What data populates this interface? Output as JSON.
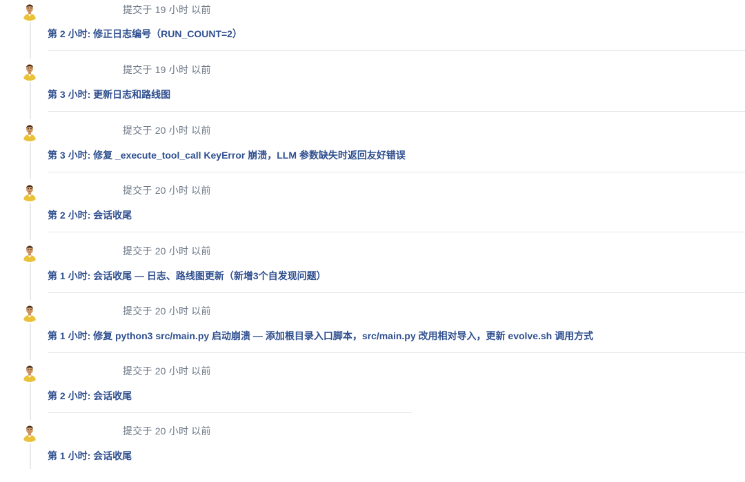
{
  "commits": [
    {
      "meta": "提交于 19 小时 以前",
      "title": "第 2 小时: 修正日志编号（RUN_COUNT=2）"
    },
    {
      "meta": "提交于 19 小时 以前",
      "title": "第 3 小时: 更新日志和路线图"
    },
    {
      "meta": "提交于 20 小时 以前",
      "title": "第 3 小时: 修复 _execute_tool_call KeyError 崩溃，LLM 参数缺失时返回友好错误"
    },
    {
      "meta": "提交于 20 小时 以前",
      "title": "第 2 小时: 会话收尾"
    },
    {
      "meta": "提交于 20 小时 以前",
      "title": "第 1 小时: 会话收尾 — 日志、路线图更新（新增3个自发现问题）"
    },
    {
      "meta": "提交于 20 小时 以前",
      "title": "第 1 小时: 修复 python3 src/main.py 启动崩溃 — 添加根目录入口脚本，src/main.py 改用相对导入，更新 evolve.sh 调用方式"
    },
    {
      "meta": "提交于 20 小时 以前",
      "title": "第 2 小时: 会话收尾"
    },
    {
      "meta": "提交于 20 小时 以前",
      "title": "第 1 小时: 会话收尾"
    }
  ],
  "colors": {
    "title": "#2f4f8f",
    "meta": "#6b7785",
    "divider": "#e3e5e8",
    "timeline": "#e6e8eb"
  },
  "icons": {
    "avatar": "user-avatar-icon"
  }
}
